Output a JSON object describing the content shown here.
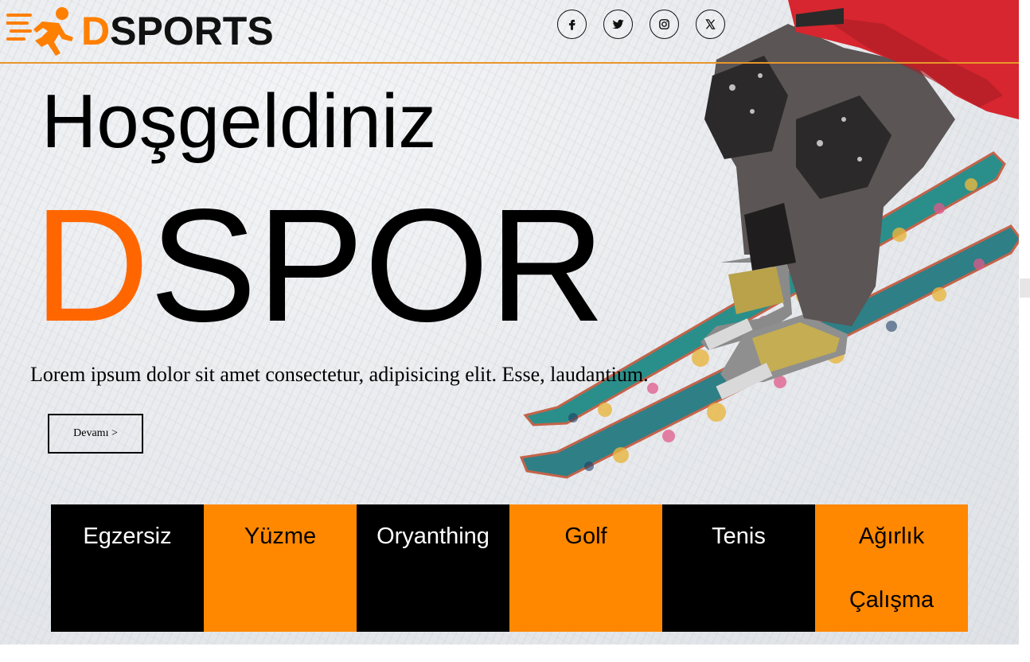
{
  "header": {
    "logo_prefix": "D",
    "logo_rest": "SPORTS",
    "social": [
      "facebook-icon",
      "twitter-icon",
      "instagram-icon",
      "x-icon"
    ]
  },
  "hero": {
    "welcome": "Hoşgeldiniz",
    "brand_accent": "D",
    "brand_rest": "SPOR",
    "description": "Lorem ipsum dolor sit amet consectetur, adipisicing elit. Esse, laudantium.",
    "more_button": "Devamı >"
  },
  "categories": [
    {
      "label": "Egzersiz",
      "style": "dark"
    },
    {
      "label": "Yüzme",
      "style": "light"
    },
    {
      "label": "Oryanthing",
      "style": "dark"
    },
    {
      "label": "Golf",
      "style": "light"
    },
    {
      "label": "Tenis",
      "style": "dark"
    },
    {
      "label": "Ağırlık Çalışma",
      "style": "light"
    }
  ],
  "colors": {
    "accent_orange": "#ff8800",
    "brand_orange": "#ff6600",
    "header_rule": "#e8962a",
    "dark_tile": "#000000"
  }
}
